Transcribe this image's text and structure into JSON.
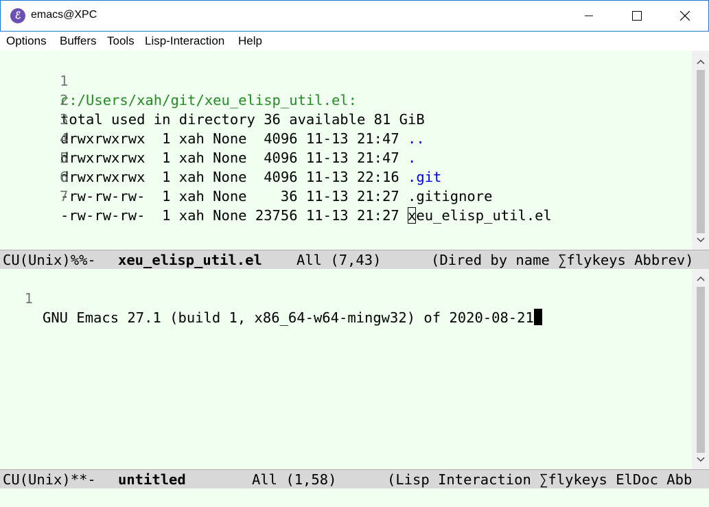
{
  "window": {
    "title": "emacs@XPC",
    "icon": "emacs-icon",
    "controls": [
      "minimize-icon",
      "maximize-icon",
      "close-icon"
    ]
  },
  "menubar": {
    "items": [
      "Options",
      "Buffers",
      "Tools",
      "Lisp-Interaction",
      "Help"
    ]
  },
  "top_buffer": {
    "lines": [
      {
        "num": "1",
        "text": "c:/Users/xah/git/xeu_elisp_util.el:"
      },
      {
        "num": "2",
        "text": "total used in directory 36 available 81 GiB"
      },
      {
        "num": "3",
        "text": "drwxrwxrwx  1 xah None  4096 11-13 21:47 ",
        "name": ".."
      },
      {
        "num": "4",
        "text": "drwxrwxrwx  1 xah None  4096 11-13 21:47 ",
        "name": "."
      },
      {
        "num": "5",
        "text": "drwxrwxrwx  1 xah None  4096 11-13 22:16 ",
        "name": ".git"
      },
      {
        "num": "6",
        "text": "-rw-rw-rw-  1 xah None    36 11-13 21:27 ",
        "name": ".gitignore"
      },
      {
        "num": "7",
        "text": "-rw-rw-rw-  1 xah None 23756 11-13 21:27 ",
        "cursor_char": "x",
        "name": "eu_elisp_util.el"
      }
    ],
    "modeline": {
      "state": "CU(Unix)%%-",
      "buffer": "xeu_elisp_util.el",
      "position": "All (7,43)",
      "modes": "(Dired by name ∑flykeys Abbrev)"
    }
  },
  "bottom_buffer": {
    "lines": [
      {
        "num": "1",
        "text": "GNU Emacs 27.1 (build 1, x86_64-w64-mingw32) of 2020-08-21"
      }
    ],
    "modeline": {
      "state": "CU(Unix)**-",
      "buffer": "untitled",
      "position": "All (1,58)",
      "modes": "(Lisp Interaction ∑flykeys ElDoc Abb"
    }
  },
  "colors": {
    "buffer_bg": "#f0fff0",
    "dir_path": "#228b22",
    "dir_name": "#0000ee",
    "line_number": "#777777",
    "modeline_bg": "#d8d8d8"
  }
}
